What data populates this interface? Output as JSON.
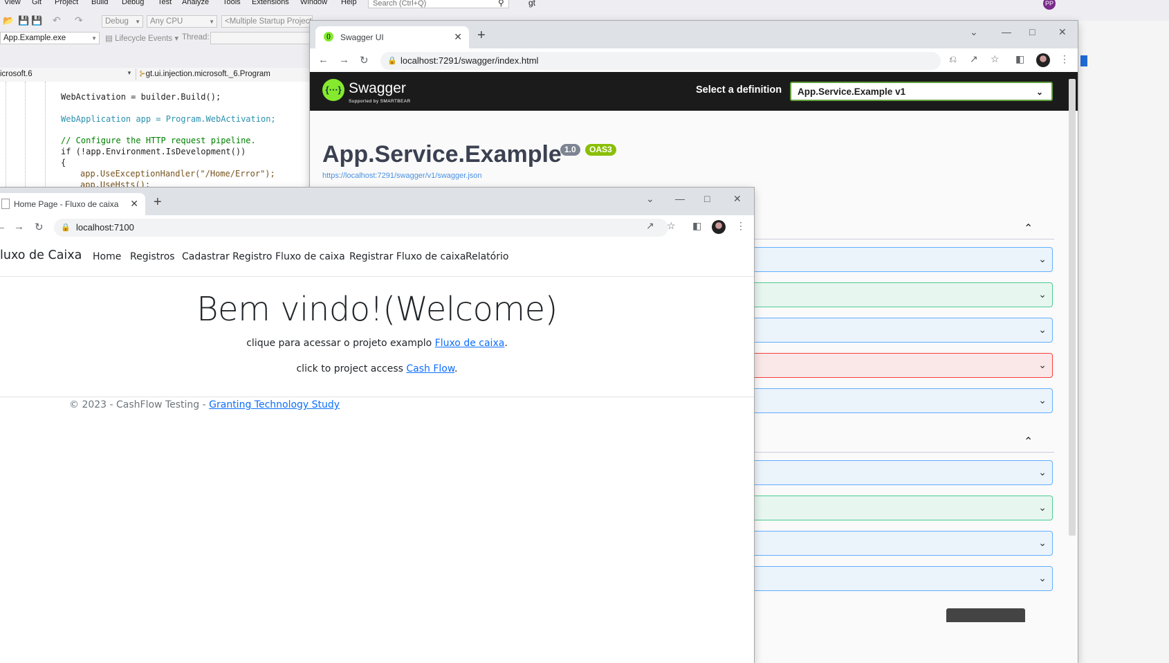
{
  "vs": {
    "menu": [
      "View",
      "Git",
      "Project",
      "Build",
      "Debug",
      "Test",
      "Analyze",
      "Tools",
      "Extensions",
      "Window",
      "Help"
    ],
    "search_placeholder": "Search (Ctrl+Q)",
    "solution_short": "gt",
    "avatar_initials": "PP",
    "config": "Debug",
    "platform": "Any CPU",
    "startup": "<Multiple Startup Projects>",
    "process": "App.Example.exe",
    "lifecycle": "Lifecycle Events",
    "thread_label": "Thread:",
    "nav_left": "icrosoft.6",
    "nav_right": "gt.ui.injection.microsoft._6.Program",
    "code": [
      "WebActivation = builder.Build();",
      "WebApplication app = Program.WebActivation;",
      "// Configure the HTTP request pipeline.",
      "if (!app.Environment.IsDevelopment())",
      "{",
      "app.UseExceptionHandler(\"/Home/Error\");",
      "app.UseHsts();"
    ]
  },
  "swagger_window": {
    "tab_title": "Swagger UI",
    "url": "localhost:7291/swagger/index.html",
    "brand": "Swagger",
    "brand_sub": "Supported by SMARTBEAR",
    "select_label": "Select a definition",
    "select_value": "App.Service.Example v1",
    "api_title": "App.Service.Example",
    "version_badge": "1.0",
    "oas_badge": "OAS3",
    "spec_url": "https://localhost:7291/swagger/v1/swagger.json",
    "colors": {
      "get": "#61affe",
      "post": "#49cc90",
      "delete": "#f93e3e",
      "header": "#1b1b1b",
      "accent": "#85ea2d"
    },
    "operations_group1": [
      "get",
      "post",
      "get",
      "delete",
      "get"
    ],
    "operations_group2": [
      "get",
      "post",
      "get",
      "get"
    ]
  },
  "cash_window": {
    "tab_title": "Home Page - Fluxo de caixa",
    "url": "localhost:7100",
    "brand": "luxo de Caixa",
    "nav": [
      "Home",
      "Registros",
      "Cadastrar Registro",
      "Fluxo de caixa",
      "Registrar Fluxo de caixa",
      "Relatório"
    ],
    "hero": "Bem vindo!(Welcome)",
    "line1_text": "clique para acessar o projeto examplo ",
    "line1_link": "Fluxo de caixa",
    "line2_text": "click to project access ",
    "line2_link": "Cash Flow",
    "period": ".",
    "footer_text": "© 2023 - CashFlow Testing - ",
    "footer_link": "Granting Technology Study"
  }
}
